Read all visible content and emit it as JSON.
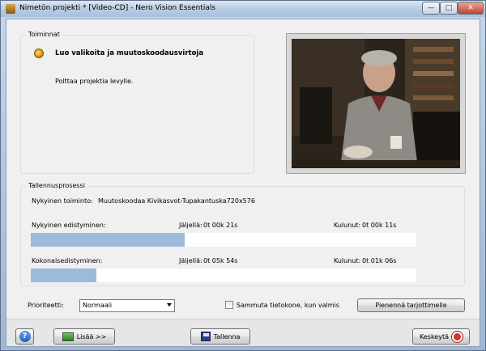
{
  "window": {
    "title": "Nimetön projekti * [Video-CD] - Nero Vision Essentials",
    "min_glyph": "—",
    "max_glyph": "□",
    "close_glyph": "✕"
  },
  "actions": {
    "group_label": "Toiminnat",
    "task_title": "Luo valikoita ja muutoskoodausvirtoja",
    "task_description": "Polttaa projektia levylle."
  },
  "recording": {
    "group_label": "Tallennusprosessi",
    "current_task_label": "Nykyinen toiminto:",
    "current_task_value": "Muutoskoodaa Kivikasvot-Tupakantuska720x576",
    "current_progress_label": "Nykyinen edistyminen:",
    "current_remaining_label": "Jäljellä:",
    "current_remaining_value": "0t 00k 21s",
    "current_elapsed_label": "Kulunut:",
    "current_elapsed_value": "0t 00k 11s",
    "current_progress_fraction": 0.4,
    "total_progress_label": "Kokonaisedistyminen:",
    "total_remaining_label": "Jäljellä:",
    "total_remaining_value": "0t 05k 54s",
    "total_elapsed_label": "Kulunut:",
    "total_elapsed_value": "0t 01k 06s",
    "total_progress_fraction": 0.17
  },
  "options": {
    "priority_label": "Prioriteetti:",
    "priority_value": "Normaali",
    "shutdown_label": "Sammuta tietokone, kun valmis",
    "shutdown_checked": false,
    "minimize_button": "Pienennä tarjottimelle"
  },
  "footer": {
    "help_glyph": "?",
    "more_button": "Lisää >>",
    "save_button": "Tallenna",
    "cancel_button": "Keskeytä"
  },
  "colors": {
    "progress_fill": "#9db9dc",
    "cancel_icon": "#d8332a"
  }
}
